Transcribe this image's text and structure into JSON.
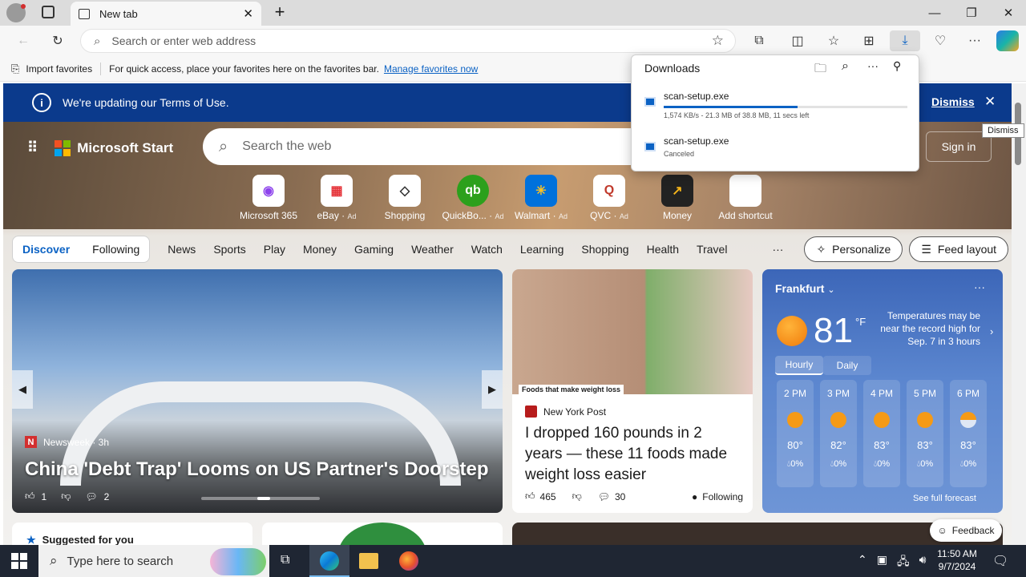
{
  "browser": {
    "tab_title": "New tab",
    "address_placeholder": "Search or enter web address",
    "favorites": {
      "import_label": "Import favorites",
      "message": "For quick access, place your favorites here on the favorites bar.",
      "manage_link": "Manage favorites now"
    }
  },
  "downloads": {
    "title": "Downloads",
    "items": [
      {
        "name": "scan-setup.exe",
        "status": "1,574 KB/s - 21.3 MB of 38.8 MB, 11 secs left",
        "progress": 0.55
      },
      {
        "name": "scan-setup.exe",
        "status": "Canceled"
      }
    ]
  },
  "banner": {
    "text": "We're updating our Terms of Use.",
    "dismiss": "Dismiss",
    "tooltip": "Dismiss"
  },
  "start": {
    "brand": "Microsoft Start",
    "search_placeholder": "Search the web",
    "sign_in": "Sign in",
    "quick_links": [
      {
        "label": "Microsoft 365",
        "ad": ""
      },
      {
        "label": "eBay",
        "ad": "Ad"
      },
      {
        "label": "Shopping",
        "ad": ""
      },
      {
        "label": "QuickBo...",
        "ad": "Ad"
      },
      {
        "label": "Walmart",
        "ad": "Ad"
      },
      {
        "label": "QVC",
        "ad": "Ad"
      },
      {
        "label": "Money",
        "ad": ""
      },
      {
        "label": "Add shortcut",
        "ad": ""
      }
    ]
  },
  "nav": {
    "discover": "Discover",
    "following": "Following",
    "items": [
      "News",
      "Sports",
      "Play",
      "Money",
      "Gaming",
      "Weather",
      "Watch",
      "Learning",
      "Shopping",
      "Health",
      "Travel"
    ],
    "more": "···",
    "personalize": "Personalize",
    "feed_layout": "Feed layout"
  },
  "cards": {
    "main": {
      "source": "Newsweek · 3h",
      "headline": "China 'Debt Trap' Looms on US Partner's Doorstep",
      "likes": "1",
      "comments": "2"
    },
    "second": {
      "image_caption": "Foods that make weight loss",
      "source": "New York Post",
      "headline": "I dropped 160 pounds in 2 years — these 11 foods made weight loss easier",
      "likes": "465",
      "comments": "30",
      "following": "Following"
    },
    "suggested": "Suggested for you"
  },
  "weather": {
    "city": "Frankfurt",
    "temp": "81",
    "unit": "°F",
    "alert": "Temperatures may be near the record high for Sep. 7 in 3 hours",
    "tab_hourly": "Hourly",
    "tab_daily": "Daily",
    "hours": [
      {
        "time": "2 PM",
        "temp": "80°",
        "precip": "0%"
      },
      {
        "time": "3 PM",
        "temp": "82°",
        "precip": "0%"
      },
      {
        "time": "4 PM",
        "temp": "83°",
        "precip": "0%"
      },
      {
        "time": "5 PM",
        "temp": "83°",
        "precip": "0%"
      },
      {
        "time": "6 PM",
        "temp": "83°",
        "precip": "0%"
      }
    ],
    "forecast_link": "See full forecast"
  },
  "feedback": "Feedback",
  "taskbar": {
    "search_placeholder": "Type here to search",
    "time": "11:50 AM",
    "date": "9/7/2024"
  },
  "colors": {
    "accent": "#0b62c4",
    "banner": "#0b3a8c",
    "progress": "#0b62c4"
  }
}
